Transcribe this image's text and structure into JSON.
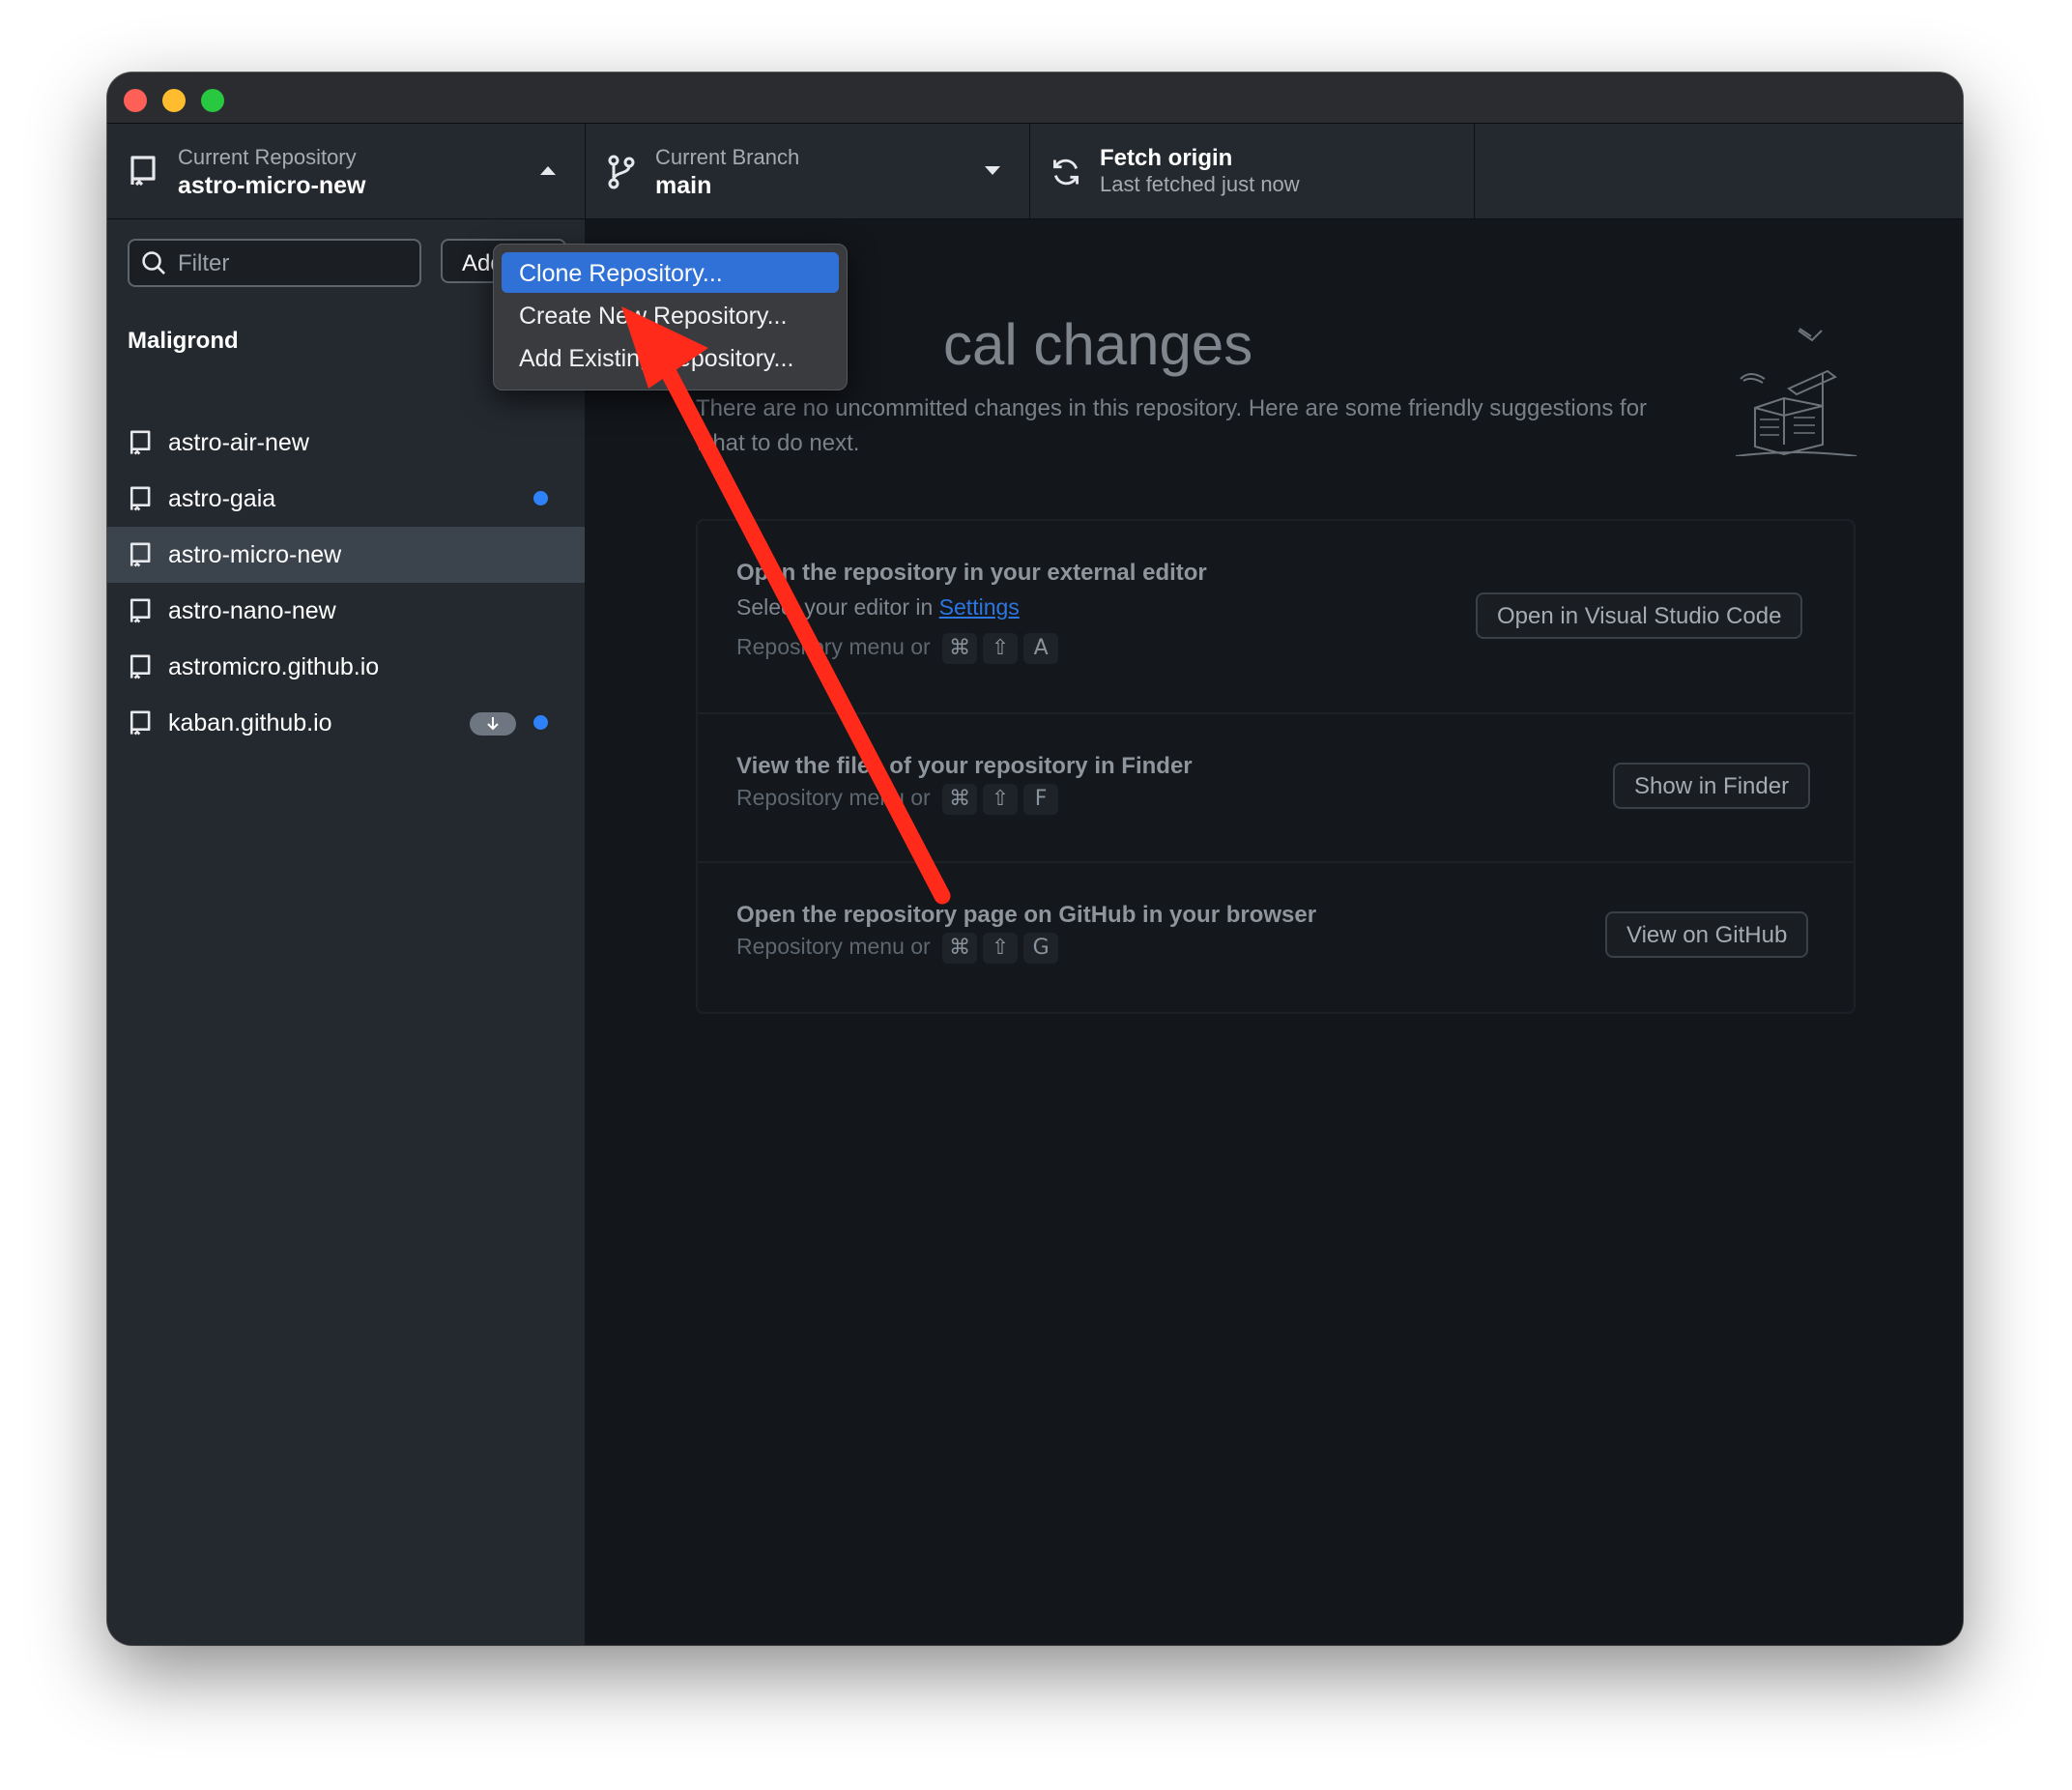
{
  "toolbar": {
    "repo": {
      "label": "Current Repository",
      "value": "astro-micro-new"
    },
    "branch": {
      "label": "Current Branch",
      "value": "main"
    },
    "fetch": {
      "title": "Fetch origin",
      "subtitle": "Last fetched just now"
    }
  },
  "sidebar": {
    "filter_placeholder": "Filter",
    "add_label": "Add",
    "group": "Maligrond",
    "repos": [
      {
        "name": "astro-air-new",
        "dot": false,
        "pull": false,
        "selected": false
      },
      {
        "name": "astro-gaia",
        "dot": true,
        "pull": false,
        "selected": false
      },
      {
        "name": "astro-micro-new",
        "dot": false,
        "pull": false,
        "selected": true
      },
      {
        "name": "astro-nano-new",
        "dot": false,
        "pull": false,
        "selected": false
      },
      {
        "name": "astromicro.github.io",
        "dot": false,
        "pull": false,
        "selected": false
      },
      {
        "name": "kaban.github.io",
        "dot": true,
        "pull": true,
        "selected": false
      }
    ]
  },
  "main": {
    "heading": "cal changes",
    "description": "There are no uncommitted changes in this repository. Here are some friendly suggestions for what to do next.",
    "cards": [
      {
        "title": "Open the repository in your external editor",
        "subtitle_prefix": "Select your editor in ",
        "subtitle_link": "Settings",
        "hint": "Repository menu or",
        "keys": [
          "⌘",
          "⇧",
          "A"
        ],
        "button": "Open in Visual Studio Code"
      },
      {
        "title": "View the files of your repository in Finder",
        "hint": "Repository menu or",
        "keys": [
          "⌘",
          "⇧",
          "F"
        ],
        "button": "Show in Finder"
      },
      {
        "title": "Open the repository page on GitHub in your browser",
        "hint": "Repository menu or",
        "keys": [
          "⌘",
          "⇧",
          "G"
        ],
        "button": "View on GitHub"
      }
    ]
  },
  "menu": {
    "items": [
      "Clone Repository...",
      "Create New Repository...",
      "Add Existing Repository..."
    ],
    "highlighted": 0
  },
  "colors": {
    "accent": "#2f81f7",
    "menu_highlight": "#2f71d6",
    "annotation_arrow": "#ff2a1a"
  }
}
